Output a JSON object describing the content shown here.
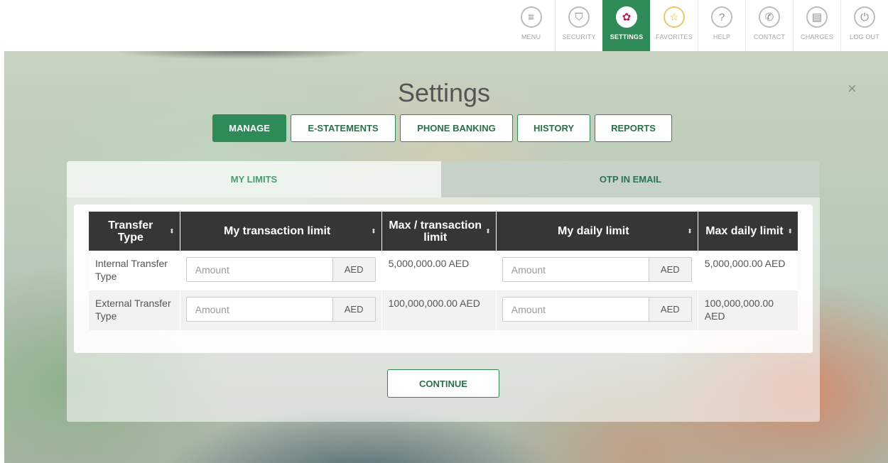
{
  "topnav": [
    {
      "key": "menu",
      "label": "MENU",
      "icon": "menu-icon",
      "glyph": "≡"
    },
    {
      "key": "security",
      "label": "SECURITY",
      "icon": "shield-icon",
      "glyph": "⛉"
    },
    {
      "key": "settings",
      "label": "SETTINGS",
      "icon": "gear-icon",
      "glyph": "✿"
    },
    {
      "key": "favorites",
      "label": "FAVORITES",
      "icon": "star-icon",
      "glyph": "☆"
    },
    {
      "key": "help",
      "label": "HELP",
      "icon": "question-icon",
      "glyph": "?"
    },
    {
      "key": "contact",
      "label": "CONTACT",
      "icon": "phone-icon",
      "glyph": "✆"
    },
    {
      "key": "charges",
      "label": "CHARGES",
      "icon": "document-icon",
      "glyph": "▤"
    },
    {
      "key": "logout",
      "label": "LOG OUT",
      "icon": "power-icon",
      "glyph": "⏻"
    }
  ],
  "page": {
    "title": "Settings",
    "close_glyph": "×"
  },
  "tabs": [
    {
      "label": "MANAGE"
    },
    {
      "label": "E-STATEMENTS"
    },
    {
      "label": "PHONE BANKING"
    },
    {
      "label": "HISTORY"
    },
    {
      "label": "REPORTS"
    }
  ],
  "subtabs": [
    {
      "label": "MY LIMITS"
    },
    {
      "label": "OTP IN EMAIL"
    }
  ],
  "table": {
    "headers": [
      "Transfer Type",
      "My transaction limit",
      "Max / transaction limit",
      "My daily limit",
      "Max daily limit"
    ],
    "sort_glyph": "⬍",
    "rows": [
      {
        "type": "Internal Transfer Type",
        "my_tx_placeholder": "Amount",
        "my_tx_currency": "AED",
        "max_tx": "5,000,000.00 AED",
        "my_daily_placeholder": "Amount",
        "my_daily_currency": "AED",
        "max_daily": "5,000,000.00 AED"
      },
      {
        "type": "External Transfer Type",
        "my_tx_placeholder": "Amount",
        "my_tx_currency": "AED",
        "max_tx": "100,000,000.00 AED",
        "my_daily_placeholder": "Amount",
        "my_daily_currency": "AED",
        "max_daily": "100,000,000.00 AED"
      }
    ]
  },
  "continue_label": "CONTINUE",
  "colors": {
    "accent": "#2e8a57",
    "header_dark": "#363636",
    "settings_icon": "#b0224a"
  }
}
